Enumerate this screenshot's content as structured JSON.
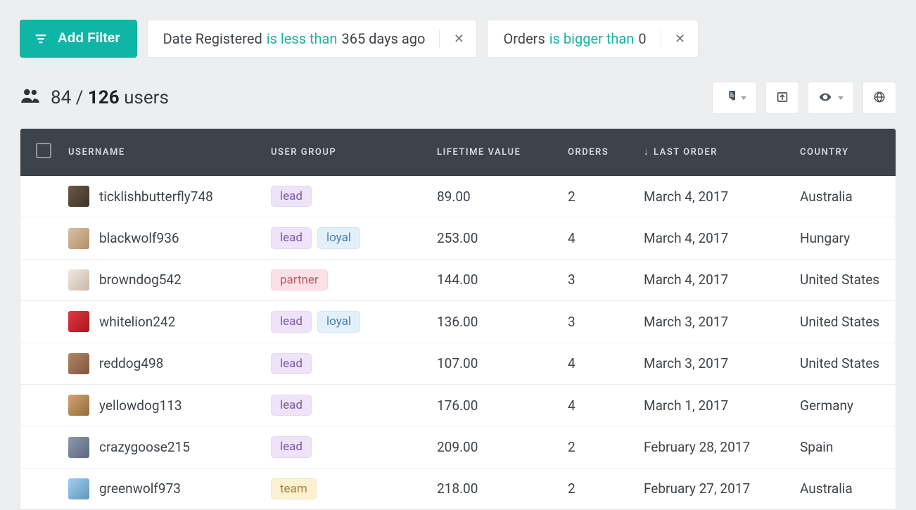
{
  "filters": {
    "add_label": "Add Filter",
    "chips": [
      {
        "field": "Date Registered",
        "op": "is less than",
        "value": "365 days ago"
      },
      {
        "field": "Orders",
        "op": "is bigger than",
        "value": "0"
      }
    ]
  },
  "count": {
    "filtered": "84",
    "separator": " / ",
    "total": "126",
    "noun": " users"
  },
  "columns": {
    "username": "USERNAME",
    "group": "USER GROUP",
    "lifetime": "LIFETIME VALUE",
    "orders": "ORDERS",
    "last_order": "LAST ORDER",
    "country": "COUNTRY",
    "sort_indicator": "↓"
  },
  "tag_styles": {
    "lead": "tag-lead",
    "loyal": "tag-loyal",
    "partner": "tag-partner",
    "team": "tag-team"
  },
  "rows": [
    {
      "avatar_class": "av0",
      "username": "ticklishbutterfly748",
      "groups": [
        "lead"
      ],
      "lifetime": "89.00",
      "orders": "2",
      "last_order": "March 4, 2017",
      "country": "Australia"
    },
    {
      "avatar_class": "av1",
      "username": "blackwolf936",
      "groups": [
        "lead",
        "loyal"
      ],
      "lifetime": "253.00",
      "orders": "4",
      "last_order": "March 4, 2017",
      "country": "Hungary"
    },
    {
      "avatar_class": "av2",
      "username": "browndog542",
      "groups": [
        "partner"
      ],
      "lifetime": "144.00",
      "orders": "3",
      "last_order": "March 4, 2017",
      "country": "United States"
    },
    {
      "avatar_class": "av3",
      "username": "whitelion242",
      "groups": [
        "lead",
        "loyal"
      ],
      "lifetime": "136.00",
      "orders": "3",
      "last_order": "March 3, 2017",
      "country": "United States"
    },
    {
      "avatar_class": "av4",
      "username": "reddog498",
      "groups": [
        "lead"
      ],
      "lifetime": "107.00",
      "orders": "4",
      "last_order": "March 3, 2017",
      "country": "United States"
    },
    {
      "avatar_class": "av5",
      "username": "yellowdog113",
      "groups": [
        "lead"
      ],
      "lifetime": "176.00",
      "orders": "4",
      "last_order": "March 1, 2017",
      "country": "Germany"
    },
    {
      "avatar_class": "av6",
      "username": "crazygoose215",
      "groups": [
        "lead"
      ],
      "lifetime": "209.00",
      "orders": "2",
      "last_order": "February 28, 2017",
      "country": "Spain"
    },
    {
      "avatar_class": "av7",
      "username": "greenwolf973",
      "groups": [
        "team"
      ],
      "lifetime": "218.00",
      "orders": "2",
      "last_order": "February 27, 2017",
      "country": "Australia"
    }
  ]
}
